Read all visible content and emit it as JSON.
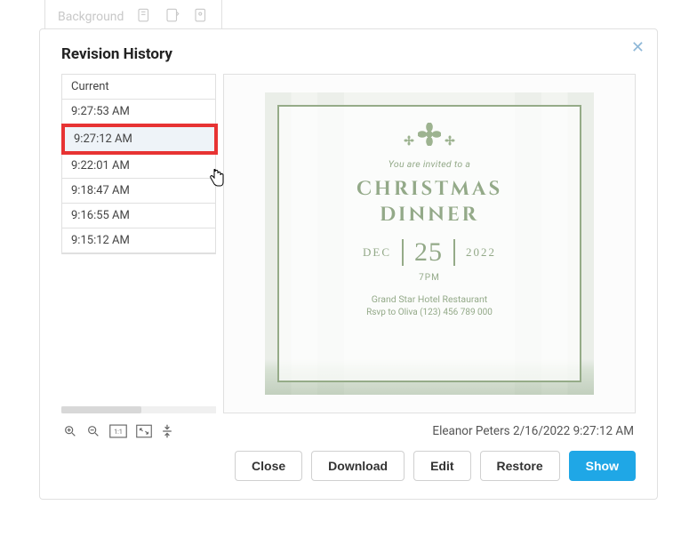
{
  "bg": {
    "label": "Background"
  },
  "modal": {
    "title": "Revision History",
    "revisions": [
      {
        "label": "Current"
      },
      {
        "label": "9:27:53 AM"
      },
      {
        "label": "9:27:12 AM",
        "selected": true
      },
      {
        "label": "9:22:01 AM"
      },
      {
        "label": "9:18:47 AM"
      },
      {
        "label": "9:16:55 AM"
      },
      {
        "label": "9:15:12 AM"
      }
    ],
    "preview": {
      "invited": "You are invited to a",
      "title1": "Christmas",
      "title2": "Dinner",
      "month": "DEC",
      "day": "25",
      "year": "2022",
      "time": "7PM",
      "venue": "Grand Star Hotel Restaurant",
      "rsvp": "Rsvp to Oliva (123) 456 789 000"
    },
    "meta": "Eleanor Peters 2/16/2022 9:27:12 AM",
    "buttons": {
      "close": "Close",
      "download": "Download",
      "edit": "Edit",
      "restore": "Restore",
      "show": "Show"
    }
  }
}
